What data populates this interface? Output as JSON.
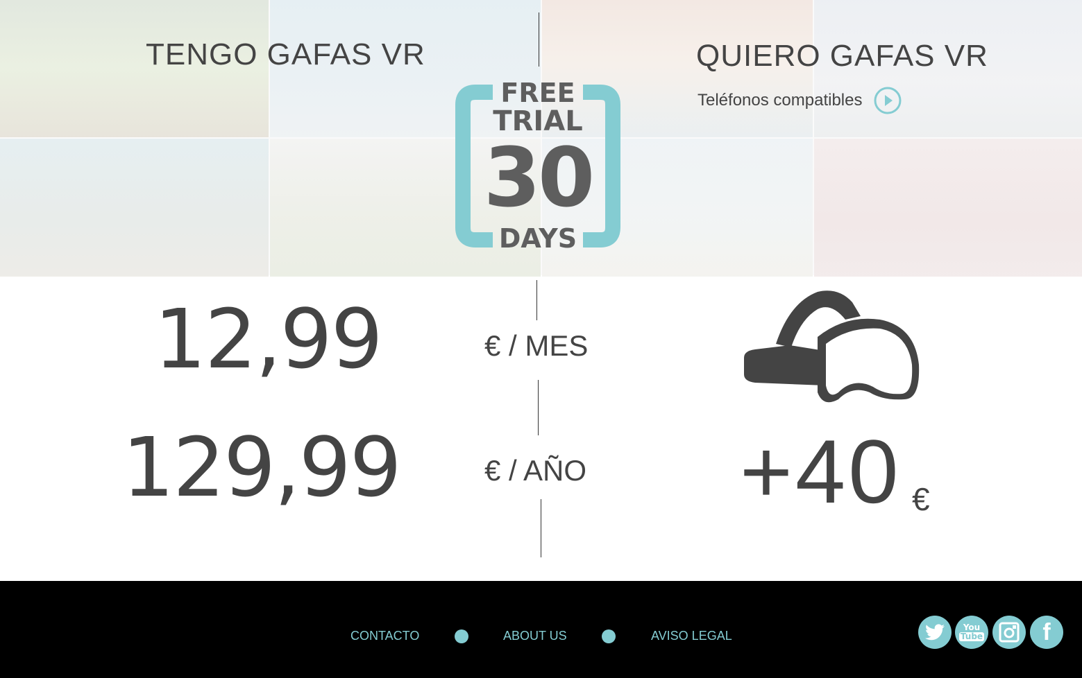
{
  "hero": {
    "left_title": "TENGO GAFAS VR",
    "right_title": "QUIERO GAFAS VR",
    "compatible_link": "Teléfonos compatibles",
    "badge": {
      "line1": "FREE",
      "line2": "TRIAL",
      "number": "30",
      "line3": "DAYS",
      "accent": "#84ccd2"
    }
  },
  "pricing": {
    "monthly_price": "12,99",
    "monthly_unit": "€ / MES",
    "yearly_price": "129,99",
    "yearly_unit": "€ / AÑO",
    "glasses_extra": "+40",
    "glasses_currency": "€"
  },
  "footer": {
    "links": [
      "CONTACTO",
      "ABOUT US",
      "AVISO LEGAL"
    ],
    "social": [
      "twitter-icon",
      "youtube-icon",
      "instagram-icon",
      "facebook-icon"
    ],
    "youtube_text": [
      "You",
      "Tube"
    ],
    "accent": "#84ccd2"
  }
}
